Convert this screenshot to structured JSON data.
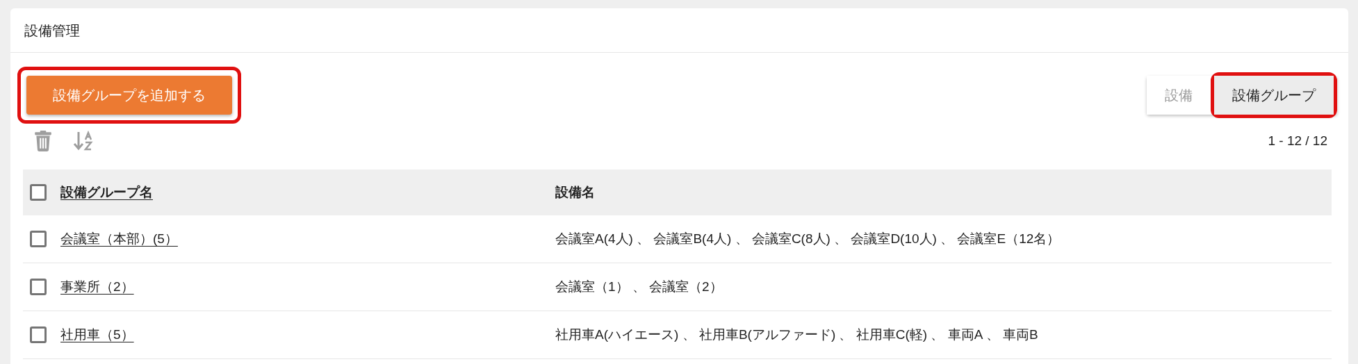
{
  "card": {
    "title": "設備管理"
  },
  "add_button": {
    "label": "設備グループを追加する",
    "highlighted": true
  },
  "view_toggle": [
    {
      "label": "設備",
      "selected": false,
      "highlighted": false
    },
    {
      "label": "設備グループ",
      "selected": true,
      "highlighted": true
    }
  ],
  "pagination": "1 - 12 / 12",
  "table": {
    "select_all_checked": false,
    "columns": [
      "設備グループ名",
      "設備名"
    ],
    "rows": [
      {
        "checked": false,
        "group": "会議室（本部）(5）",
        "equipment": "会議室A(4人) 、 会議室B(4人) 、 会議室C(8人) 、 会議室D(10人) 、 会議室E（12名）"
      },
      {
        "checked": false,
        "group": "事業所（2）",
        "equipment": "会議室（1） 、 会議室（2）"
      },
      {
        "checked": false,
        "group": "社用車（5）",
        "equipment": "社用車A(ハイエース) 、 社用車B(アルファード) 、 社用車C(軽) 、 車両A 、 車両B"
      }
    ]
  }
}
